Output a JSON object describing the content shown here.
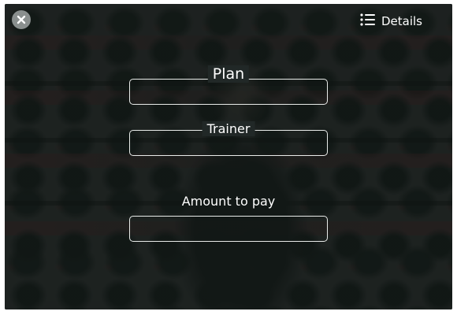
{
  "header": {
    "close_icon": "close-icon",
    "details_icon": "list-icon",
    "details_label": "Details"
  },
  "form": {
    "plan": {
      "label": "Plan",
      "value": ""
    },
    "trainer": {
      "label": "Trainer",
      "value": ""
    },
    "amount": {
      "label": "Amount to pay",
      "value": ""
    }
  },
  "colors": {
    "overlay": "#1b201f",
    "text": "#ffffff",
    "field_border": "#e9ecea",
    "close_button_bg": "#8a8f8e"
  }
}
